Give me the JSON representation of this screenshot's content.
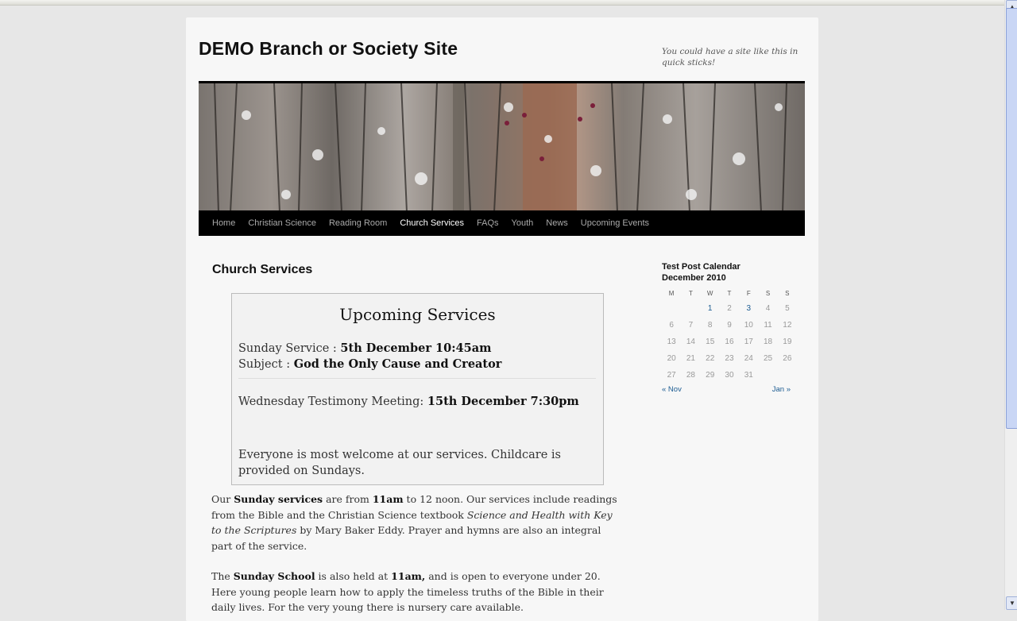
{
  "site": {
    "title": "DEMO Branch or Society Site",
    "tagline": "You could have a site like this in quick sticks!"
  },
  "nav": {
    "items": [
      "Home",
      "Christian Science",
      "Reading Room",
      "Church Services",
      "FAQs",
      "Youth",
      "News",
      "Upcoming Events"
    ],
    "current": "Church Services"
  },
  "page": {
    "heading": "Church Services"
  },
  "services_box": {
    "title": "Upcoming Services",
    "sunday_label": "Sunday Service : ",
    "sunday_value": "5th December 10:45am",
    "subject_label": "Subject : ",
    "subject_value": "God the Only Cause and Creator",
    "wednesday_label": "Wednesday Testimony Meeting: ",
    "wednesday_value": "15th December 7:30pm",
    "welcome": "Everyone is most welcome at our services. Childcare is provided on Sundays."
  },
  "paragraph1": {
    "t1": "Our ",
    "b1": "Sunday services",
    "t2": " are from ",
    "b2": "11am",
    "t3": " to 12 noon.  Our services include readings from the Bible and the Christian Science textbook ",
    "i1": "Science and Health with Key to the Scriptures",
    "t4": " by Mary Baker Eddy.  Prayer and hymns are also an integral part of the service."
  },
  "paragraph2": {
    "t1": "The ",
    "b1": "Sunday School",
    "t2": " is also held at ",
    "b2": "11am,",
    "t3": " and is open to everyone under 20.  Here young people learn how to apply the timeless truths of the Bible in their daily lives.  For the very young there is nursery care available."
  },
  "calendar": {
    "widget_title": "Test Post Calendar",
    "month": "December 2010",
    "weekdays": [
      "M",
      "T",
      "W",
      "T",
      "F",
      "S",
      "S"
    ],
    "weeks": [
      [
        "",
        "",
        "1",
        "2",
        "3",
        "4",
        "5"
      ],
      [
        "6",
        "7",
        "8",
        "9",
        "10",
        "11",
        "12"
      ],
      [
        "13",
        "14",
        "15",
        "16",
        "17",
        "18",
        "19"
      ],
      [
        "20",
        "21",
        "22",
        "23",
        "24",
        "25",
        "26"
      ],
      [
        "27",
        "28",
        "29",
        "30",
        "31",
        "",
        ""
      ]
    ],
    "linked_days": [
      "1",
      "3"
    ],
    "prev_label": "« Nov",
    "next_label": "Jan »"
  },
  "colors": {
    "nav_bg": "#000000",
    "link": "#1c5c92",
    "page_bg": "#f7f7f7"
  }
}
